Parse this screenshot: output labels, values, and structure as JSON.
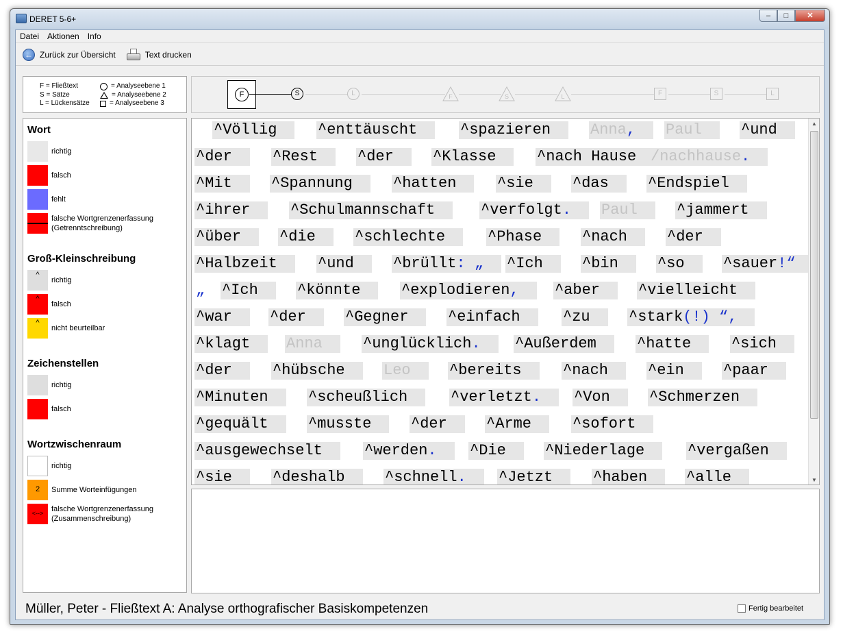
{
  "window": {
    "title": "DERET 5-6+",
    "min_symbol": "–",
    "max_symbol": "□",
    "close_symbol": "✕"
  },
  "menu": [
    "Datei",
    "Aktionen",
    "Info"
  ],
  "toolbar": {
    "back_label": "Zurück zur Übersicht",
    "back_icon": "←",
    "print_label": "Text drucken"
  },
  "legend": {
    "left": [
      "F = Fließtext",
      "S = Sätze",
      "L = Lückensätze"
    ],
    "right": [
      "= Analyseebene 1",
      "= Analyseebene 2",
      "= Analyseebene 3"
    ]
  },
  "progress": {
    "active": "F",
    "nodes": [
      {
        "shape": "circle",
        "label": "F"
      },
      {
        "shape": "circle",
        "label": "S"
      },
      {
        "shape": "circle",
        "label": "L"
      },
      {
        "shape": "triangle",
        "label": "F"
      },
      {
        "shape": "triangle",
        "label": "S"
      },
      {
        "shape": "triangle",
        "label": "L"
      },
      {
        "shape": "square",
        "label": "F"
      },
      {
        "shape": "square",
        "label": "S"
      },
      {
        "shape": "square",
        "label": "L"
      }
    ]
  },
  "sidebar": {
    "wort": {
      "title": "Wort",
      "items": [
        "richtig",
        "falsch",
        "fehlt",
        "falsche Wortgrenzenerfassung",
        "(Getrenntschreibung)"
      ]
    },
    "gross": {
      "title": "Groß-Kleinschreibung",
      "items": [
        "richtig",
        "falsch",
        "nicht beurteilbar"
      ],
      "caret": "^"
    },
    "zeichen": {
      "title": "Zeichenstellen",
      "items": [
        "richtig",
        "falsch"
      ]
    },
    "zwischen": {
      "title": "Wortzwischenraum",
      "items": [
        "richtig",
        "Summe Worteinfügungen",
        "falsche Wortgrenzenerfassung",
        "(Zusammenschreibung)"
      ],
      "count": "2",
      "arrows": "<-->"
    },
    "colors": {
      "gray": "#dedede",
      "red": "#ff0000",
      "blue": "#6b6bff",
      "yellow": "#ffd800",
      "orange": "#ff9900"
    }
  },
  "text_lines": [
    [
      [
        "^Völlig",
        ""
      ],
      [
        "^enttäuscht",
        ""
      ],
      [
        "^spazieren",
        ""
      ],
      [
        "Anna",
        "gr",
        ","
      ],
      [
        "Paul",
        "gr"
      ],
      [
        "^und",
        ""
      ]
    ],
    [
      [
        "^der",
        ""
      ],
      [
        "^Rest",
        ""
      ],
      [
        "^der",
        ""
      ],
      [
        "^Klasse",
        ""
      ],
      [
        "^nach  Hause",
        ""
      ],
      [
        "/nachhause",
        "gr",
        "."
      ]
    ],
    [
      [
        "^Mit",
        ""
      ],
      [
        "^Spannung",
        ""
      ],
      [
        "^hatten",
        ""
      ],
      [
        "^sie",
        ""
      ],
      [
        "^das",
        ""
      ],
      [
        "^Endspiel",
        ""
      ]
    ],
    [
      [
        "^ihrer",
        ""
      ],
      [
        "^Schulmannschaft",
        ""
      ],
      [
        "^verfolgt",
        "",
        " ."
      ],
      [
        "Paul",
        "gr"
      ],
      [
        "^jammert",
        ""
      ]
    ],
    [
      [
        "^über",
        ""
      ],
      [
        "^die",
        ""
      ],
      [
        "^schlechte",
        ""
      ],
      [
        "^Phase",
        ""
      ],
      [
        "^nach",
        ""
      ],
      [
        "^der",
        ""
      ]
    ],
    [
      [
        "^Halbzeit",
        ""
      ],
      [
        "^und",
        ""
      ],
      [
        "^brüllt",
        "",
        " : „"
      ],
      [
        "^Ich",
        ""
      ],
      [
        "^bin",
        ""
      ],
      [
        "^so",
        ""
      ],
      [
        "^sauer",
        "",
        " !“"
      ]
    ],
    [
      [
        "„",
        "bl-only"
      ],
      [
        "^Ich",
        ""
      ],
      [
        "^könnte",
        ""
      ],
      [
        "^explodieren",
        "",
        " ,"
      ],
      [
        "^aber",
        ""
      ],
      [
        "^vielleicht",
        ""
      ]
    ],
    [
      [
        "^war",
        ""
      ],
      [
        "^der",
        ""
      ],
      [
        "^Gegner",
        ""
      ],
      [
        "^einfach",
        ""
      ],
      [
        "^zu",
        ""
      ],
      [
        "^stark",
        "",
        " (!) “,"
      ]
    ],
    [
      [
        "^klagt",
        ""
      ],
      [
        "Anna",
        "gr"
      ],
      [
        "^unglücklich",
        "",
        " ."
      ],
      [
        "^Außerdem",
        ""
      ],
      [
        "^hatte",
        ""
      ],
      [
        "^sich",
        ""
      ]
    ],
    [
      [
        "^der",
        ""
      ],
      [
        "^hübsche",
        ""
      ],
      [
        "Leo",
        "gr"
      ],
      [
        "^bereits",
        ""
      ],
      [
        "^nach",
        ""
      ],
      [
        "^ein",
        ""
      ],
      [
        "^paar",
        ""
      ]
    ],
    [
      [
        "^Minuten",
        ""
      ],
      [
        "^scheußlich",
        ""
      ],
      [
        "^verletzt",
        "",
        " ."
      ],
      [
        "^Von",
        ""
      ],
      [
        "^Schmerzen",
        ""
      ]
    ],
    [
      [
        "^gequält",
        ""
      ],
      [
        "^musste",
        ""
      ],
      [
        "^der",
        ""
      ],
      [
        "^Arme",
        ""
      ],
      [
        "^sofort",
        ""
      ]
    ],
    [
      [
        "^ausgewechselt",
        ""
      ],
      [
        "^werden",
        "",
        " ."
      ],
      [
        "^Die",
        ""
      ],
      [
        "^Niederlage",
        ""
      ],
      [
        "^vergaßen",
        ""
      ]
    ],
    [
      [
        "^sie",
        ""
      ],
      [
        "^deshalb",
        ""
      ],
      [
        "^schnell",
        "",
        " ."
      ],
      [
        "^Jetzt",
        ""
      ],
      [
        "^haben",
        ""
      ],
      [
        "^alle",
        ""
      ]
    ]
  ],
  "status": {
    "text": "Müller, Peter -  Fließtext A:  Analyse orthografischer Basiskompetenzen",
    "done_label": "Fertig bearbeitet"
  }
}
